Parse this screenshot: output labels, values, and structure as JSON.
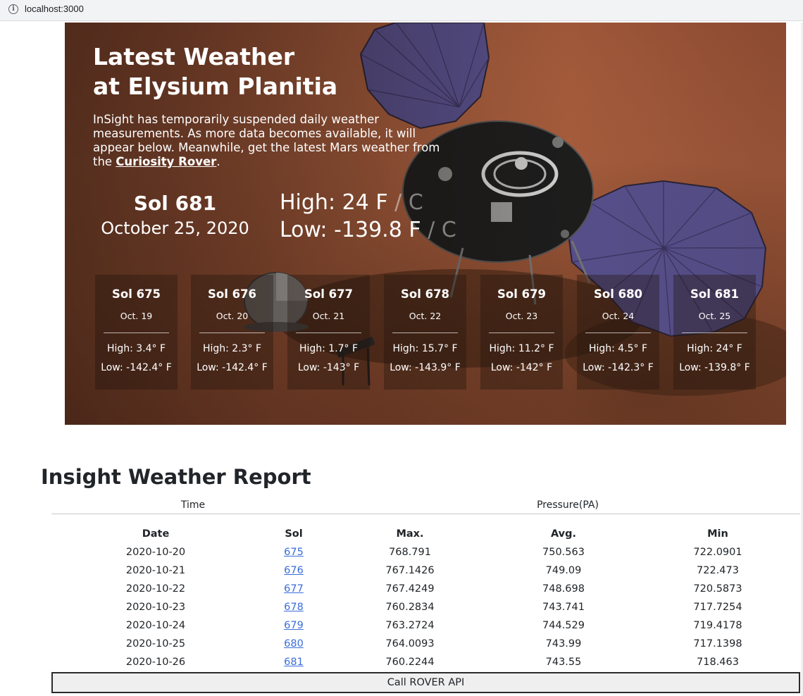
{
  "browser": {
    "url": "localhost:3000"
  },
  "hero": {
    "title_line1": "Latest Weather",
    "title_line2": "at Elysium Planitia",
    "description_prefix": "InSight has temporarily suspended daily weather measurements. As more data becomes available, it will appear below. Meanwhile, get the latest Mars weather from the ",
    "link_text": "Curiosity Rover",
    "description_suffix": ".",
    "current": {
      "sol": "Sol 681",
      "date": "October 25, 2020",
      "high_label": "High:",
      "high_value": "24",
      "low_label": "Low:",
      "low_value": "-139.8",
      "unit_f": "F",
      "unit_sep": "/",
      "unit_c": "C"
    },
    "cards": [
      {
        "sol": "Sol 675",
        "date": "Oct. 19",
        "high": "High: 3.4° F",
        "low": "Low: -142.4° F"
      },
      {
        "sol": "Sol 676",
        "date": "Oct. 20",
        "high": "High: 2.3° F",
        "low": "Low: -142.4° F"
      },
      {
        "sol": "Sol 677",
        "date": "Oct. 21",
        "high": "High: 1.7° F",
        "low": "Low: -143° F"
      },
      {
        "sol": "Sol 678",
        "date": "Oct. 22",
        "high": "High: 15.7° F",
        "low": "Low: -143.9° F"
      },
      {
        "sol": "Sol 679",
        "date": "Oct. 23",
        "high": "High: 11.2° F",
        "low": "Low: -142° F"
      },
      {
        "sol": "Sol 680",
        "date": "Oct. 24",
        "high": "High: 4.5° F",
        "low": "Low: -142.3° F"
      },
      {
        "sol": "Sol 681",
        "date": "Oct. 25",
        "high": "High: 24° F",
        "low": "Low: -139.8° F"
      }
    ]
  },
  "report": {
    "title": "Insight Weather Report",
    "group_time": "Time",
    "group_pressure": "Pressure(PA)",
    "headers": {
      "date": "Date",
      "sol": "Sol",
      "max": "Max.",
      "avg": "Avg.",
      "min": "Min"
    },
    "rows": [
      {
        "date": "2020-10-20",
        "sol": "675",
        "max": "768.791",
        "avg": "750.563",
        "min": "722.0901"
      },
      {
        "date": "2020-10-21",
        "sol": "676",
        "max": "767.1426",
        "avg": "749.09",
        "min": "722.473"
      },
      {
        "date": "2020-10-22",
        "sol": "677",
        "max": "767.4249",
        "avg": "748.698",
        "min": "720.5873"
      },
      {
        "date": "2020-10-23",
        "sol": "678",
        "max": "760.2834",
        "avg": "743.741",
        "min": "717.7254"
      },
      {
        "date": "2020-10-24",
        "sol": "679",
        "max": "763.2724",
        "avg": "744.529",
        "min": "719.4178"
      },
      {
        "date": "2020-10-25",
        "sol": "680",
        "max": "764.0093",
        "avg": "743.99",
        "min": "717.1398"
      },
      {
        "date": "2020-10-26",
        "sol": "681",
        "max": "760.2244",
        "avg": "743.55",
        "min": "718.463"
      }
    ],
    "button_label": "Call ROVER API"
  },
  "colors": {
    "link": "#3a6ed8",
    "hero_ground": "#9e5638",
    "panel_blue": "#5a5290"
  }
}
